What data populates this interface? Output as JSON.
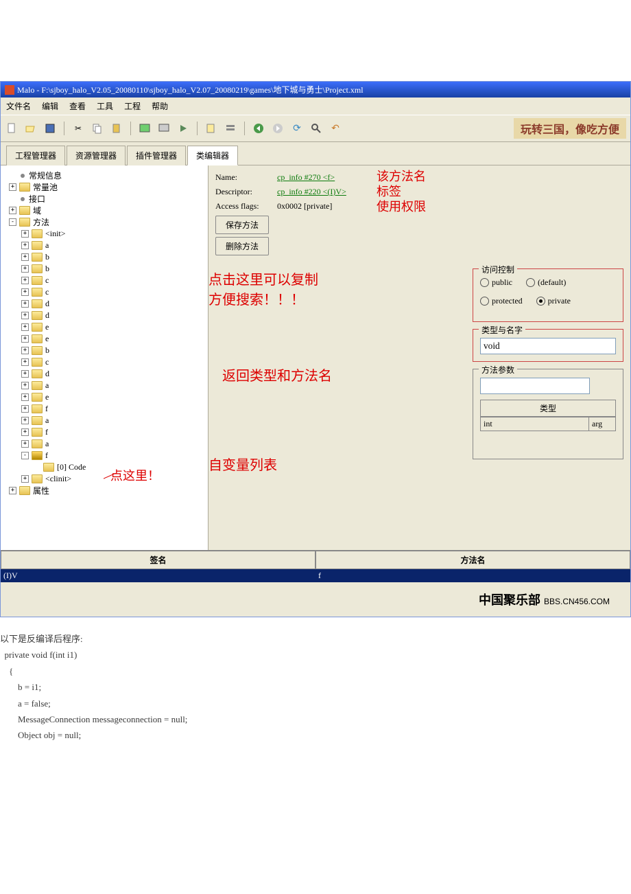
{
  "titlebar": "Malo - F:\\sjboy_halo_V2.05_20080110\\sjboy_halo_V2.07_20080219\\games\\地下城与勇士\\Project.xml",
  "menu": [
    "文件名",
    "编辑",
    "查看",
    "工具",
    "工程",
    "帮助"
  ],
  "banner": "玩转三国，像吃方便",
  "tabs": [
    "工程管理器",
    "资源管理器",
    "插件管理器",
    "类编辑器"
  ],
  "active_tab": 3,
  "tree": {
    "items": [
      {
        "d": 0,
        "t": "node",
        "icon": "bullet",
        "label": "常规信息",
        "toggle": ""
      },
      {
        "d": 0,
        "t": "node",
        "icon": "folder",
        "label": "常量池",
        "toggle": "+"
      },
      {
        "d": 0,
        "t": "node",
        "icon": "bullet",
        "label": "接口",
        "toggle": ""
      },
      {
        "d": 0,
        "t": "node",
        "icon": "folder",
        "label": "域",
        "toggle": "+"
      },
      {
        "d": 0,
        "t": "node",
        "icon": "folder",
        "label": "方法",
        "toggle": "-"
      },
      {
        "d": 1,
        "t": "node",
        "icon": "folder",
        "label": "<init>",
        "toggle": "+"
      },
      {
        "d": 1,
        "t": "node",
        "icon": "folder",
        "label": "a",
        "toggle": "+"
      },
      {
        "d": 1,
        "t": "node",
        "icon": "folder",
        "label": "b",
        "toggle": "+"
      },
      {
        "d": 1,
        "t": "node",
        "icon": "folder",
        "label": "b",
        "toggle": "+"
      },
      {
        "d": 1,
        "t": "node",
        "icon": "folder",
        "label": "c",
        "toggle": "+"
      },
      {
        "d": 1,
        "t": "node",
        "icon": "folder",
        "label": "c",
        "toggle": "+"
      },
      {
        "d": 1,
        "t": "node",
        "icon": "folder",
        "label": "d",
        "toggle": "+"
      },
      {
        "d": 1,
        "t": "node",
        "icon": "folder",
        "label": "d",
        "toggle": "+"
      },
      {
        "d": 1,
        "t": "node",
        "icon": "folder",
        "label": "e",
        "toggle": "+"
      },
      {
        "d": 1,
        "t": "node",
        "icon": "folder",
        "label": "e",
        "toggle": "+"
      },
      {
        "d": 1,
        "t": "node",
        "icon": "folder",
        "label": "b",
        "toggle": "+"
      },
      {
        "d": 1,
        "t": "node",
        "icon": "folder",
        "label": "c",
        "toggle": "+"
      },
      {
        "d": 1,
        "t": "node",
        "icon": "folder",
        "label": "d",
        "toggle": "+"
      },
      {
        "d": 1,
        "t": "node",
        "icon": "folder",
        "label": "a",
        "toggle": "+"
      },
      {
        "d": 1,
        "t": "node",
        "icon": "folder",
        "label": "e",
        "toggle": "+"
      },
      {
        "d": 1,
        "t": "node",
        "icon": "folder",
        "label": "f",
        "toggle": "+"
      },
      {
        "d": 1,
        "t": "node",
        "icon": "folder",
        "label": "a",
        "toggle": "+"
      },
      {
        "d": 1,
        "t": "node",
        "icon": "folder",
        "label": "f",
        "toggle": "+"
      },
      {
        "d": 1,
        "t": "node",
        "icon": "folder",
        "label": "a",
        "toggle": "+"
      },
      {
        "d": 1,
        "t": "node",
        "icon": "special",
        "label": "f",
        "toggle": "-"
      },
      {
        "d": 2,
        "t": "node",
        "icon": "folder",
        "label": "[0] Code",
        "toggle": ""
      },
      {
        "d": 1,
        "t": "node",
        "icon": "folder",
        "label": "<clinit>",
        "toggle": "+"
      },
      {
        "d": 0,
        "t": "node",
        "icon": "folder",
        "label": "属性",
        "toggle": "+"
      }
    ],
    "annotation": "点这里！"
  },
  "editor": {
    "name_label": "Name:",
    "name_value": "cp_info #270 <f>",
    "desc_label": "Descriptor:",
    "desc_value": "cp_info #220 <(I)V>",
    "flags_label": "Access flags:",
    "flags_value": "0x0002 [private]",
    "btn_save": "保存方法",
    "btn_delete": "删除方法",
    "access_title": "访问控制",
    "radios": [
      "public",
      "(default)",
      "protected",
      "private"
    ],
    "type_title": "类型与名字",
    "type_value": "void",
    "params_title": "方法参数",
    "param_col1": "类型",
    "param_type": "int",
    "param_name": "arg",
    "annots": {
      "method_name": "该方法名",
      "tag": "标签",
      "perm": "使用权限",
      "copy": "点击这里可以复制\n方便搜索！！！",
      "return": "返回类型和方法名",
      "varlist": "自变量列表"
    }
  },
  "bottom": {
    "h1": "签名",
    "h2": "方法名",
    "v1": "(I)V",
    "v2": "f"
  },
  "watermark": {
    "a": "中国聚乐部",
    "b": "BBS.CN456.COM"
  },
  "code": {
    "intro": "以下是反编译后程序:",
    "lines": [
      "  private void f(int i1)",
      "    {",
      "        b = i1;",
      "        a = false;",
      "        MessageConnection messageconnection = null;",
      "        Object obj = null;"
    ]
  }
}
